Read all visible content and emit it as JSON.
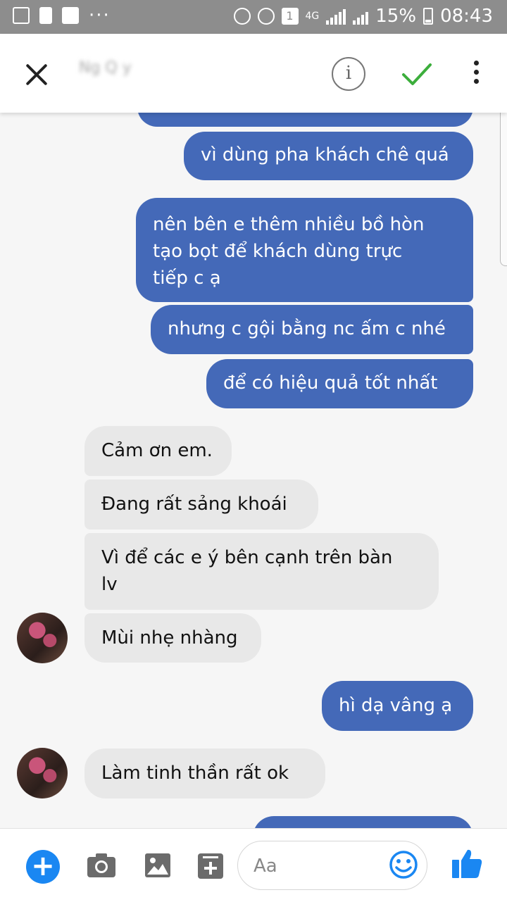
{
  "status_bar": {
    "network": "4G",
    "sim_slot": "1",
    "battery": "15%",
    "time": "08:43",
    "icons": [
      "gallery-icon",
      "alert-icon",
      "facebook-icon",
      "more-notifications-icon",
      "recycle-icon",
      "alarm-icon",
      "sim-icon",
      "signal-icon",
      "battery-icon"
    ]
  },
  "header": {
    "contact_name": "Ng   Q   y",
    "info_label": "i"
  },
  "messages": [
    {
      "side": "out",
      "text": "vì dùng pha khách chê quá"
    },
    {
      "side": "out",
      "lines": [
        "nên bên e thêm nhiều bồ hòn",
        "tạo bọt để khách dùng trực",
        "tiếp c ạ"
      ]
    },
    {
      "side": "out",
      "text": "nhưng c gội bằng nc ấm c nhé"
    },
    {
      "side": "out",
      "text": "để có hiệu quả tốt nhất"
    },
    {
      "side": "in",
      "text": "Cảm ơn em."
    },
    {
      "side": "in",
      "text": "Đang rất sảng khoái"
    },
    {
      "side": "in",
      "lines": [
        "Vì để các e ý bên cạnh trên bàn",
        "lv"
      ]
    },
    {
      "side": "in",
      "text": "Mùi nhẹ nhàng"
    },
    {
      "side": "out",
      "text": "hì dạ vâng ạ"
    },
    {
      "side": "in",
      "text": "Làm tinh thần rất ok"
    }
  ],
  "composer": {
    "placeholder": "Aa"
  },
  "colors": {
    "outgoing_bubble": "#4469b8",
    "incoming_bubble": "#e8e8e8",
    "accent": "#1a87f2",
    "check": "#3cae3c"
  }
}
